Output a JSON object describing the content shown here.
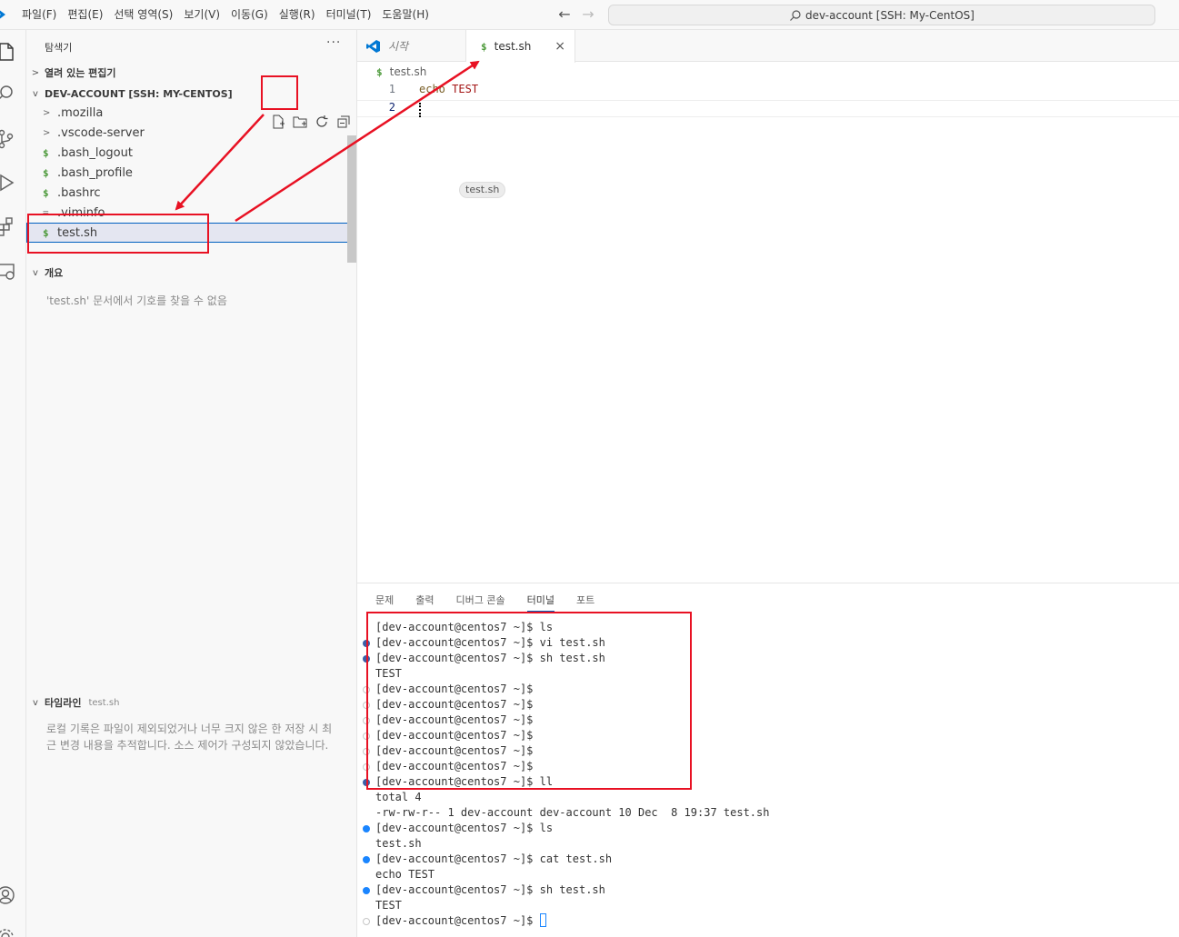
{
  "menu": [
    "파일(F)",
    "편집(E)",
    "선택 영역(S)",
    "보기(V)",
    "이동(G)",
    "실행(R)",
    "터미널(T)",
    "도움말(H)"
  ],
  "command_center": "dev-account [SSH: My-CentOS]",
  "sidebar": {
    "title": "탐색기",
    "more": "···",
    "open_editors": "열려 있는 편집기",
    "folder": "DEV-ACCOUNT [SSH: MY-CENTOS]",
    "items": [
      {
        "label": ".mozilla",
        "icon": "chevron-right-icon"
      },
      {
        "label": ".vscode-server",
        "icon": "chevron-right-icon"
      },
      {
        "label": ".bash_logout",
        "icon": "shell-file-icon"
      },
      {
        "label": ".bash_profile",
        "icon": "shell-file-icon"
      },
      {
        "label": ".bashrc",
        "icon": "shell-file-icon"
      },
      {
        "label": ".viminfo",
        "icon": "text-file-icon"
      },
      {
        "label": "test.sh",
        "icon": "shell-file-icon"
      }
    ],
    "outline": "개요",
    "outline_empty": "'test.sh' 문서에서 기호를 찾을 수 없음",
    "timeline": "타임라인",
    "timeline_file": "test.sh",
    "timeline_empty": "로컬 기록은 파일이 제외되었거나 너무 크지 않은 한 저장 시 최근 변경 내용을 추적합니다. 소스 제어가 구성되지 않았습니다."
  },
  "tabs": [
    {
      "label": "시작",
      "active": false
    },
    {
      "label": "test.sh",
      "active": true
    }
  ],
  "tab_close": "×",
  "breadcrumb": "test.sh",
  "editor": {
    "lines": [
      {
        "num": "1",
        "cmd": "echo",
        "arg": "TEST"
      },
      {
        "num": "2",
        "cmd": "",
        "arg": ""
      }
    ],
    "hover_chip": "test.sh"
  },
  "panel": {
    "tabs": [
      "문제",
      "출력",
      "디버그 콘솔",
      "터미널",
      "포트"
    ],
    "active_tab": "터미널",
    "terminal": [
      {
        "text": "[dev-account@centos7 ~]$ ls",
        "dot": "none"
      },
      {
        "text": "[dev-account@centos7 ~]$ vi test.sh",
        "dot": "navy"
      },
      {
        "text": "[dev-account@centos7 ~]$ sh test.sh",
        "dot": "navy"
      },
      {
        "text": "TEST",
        "dot": "none"
      },
      {
        "text": "[dev-account@centos7 ~]$",
        "dot": "hollow"
      },
      {
        "text": "[dev-account@centos7 ~]$",
        "dot": "hollow"
      },
      {
        "text": "[dev-account@centos7 ~]$",
        "dot": "hollow"
      },
      {
        "text": "[dev-account@centos7 ~]$",
        "dot": "hollow"
      },
      {
        "text": "[dev-account@centos7 ~]$",
        "dot": "hollow"
      },
      {
        "text": "[dev-account@centos7 ~]$",
        "dot": "hollow"
      },
      {
        "text": "[dev-account@centos7 ~]$ ll",
        "dot": "navy"
      },
      {
        "text": "total 4",
        "dot": "none"
      },
      {
        "text": "-rw-rw-r-- 1 dev-account dev-account 10 Dec  8 19:37 test.sh",
        "dot": "none"
      },
      {
        "text": "[dev-account@centos7 ~]$ ls",
        "dot": "blue"
      },
      {
        "text": "test.sh",
        "dot": "none"
      },
      {
        "text": "[dev-account@centos7 ~]$ cat test.sh",
        "dot": "blue"
      },
      {
        "text": "echo TEST",
        "dot": "none"
      },
      {
        "text": "[dev-account@centos7 ~]$ sh test.sh",
        "dot": "blue"
      },
      {
        "text": "TEST",
        "dot": "none"
      },
      {
        "text": "[dev-account@centos7 ~]$ ",
        "dot": "hollow"
      }
    ]
  },
  "colors": {
    "accent": "#005fb8",
    "annotation": "#e81123",
    "shell_icon": "#4d9a3b"
  }
}
